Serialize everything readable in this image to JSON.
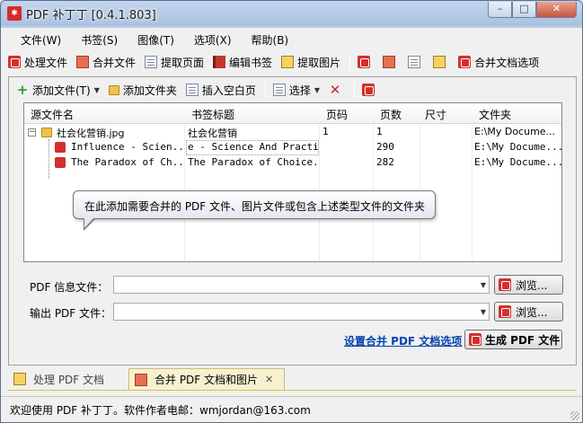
{
  "window": {
    "title": "PDF 补丁丁 [0.4.1.803]",
    "minimize": "–",
    "maximize": "□",
    "close": "✕"
  },
  "menu": [
    "文件(W)",
    "书签(S)",
    "图像(T)",
    "选项(X)",
    "帮助(B)"
  ],
  "toolbar": {
    "process_file": "处理文件",
    "merge_file": "合并文件",
    "extract_pages": "提取页面",
    "edit_bookmarks": "编辑书签",
    "extract_images": "提取图片",
    "merge_options": "合并文档选项"
  },
  "panel_toolbar": {
    "add_file": "添加文件(T)",
    "add_folder": "添加文件夹",
    "insert_blank": "插入空白页",
    "select": "选择"
  },
  "table": {
    "headers": [
      "源文件名",
      "书签标题",
      "页码",
      "页数",
      "尺寸",
      "文件夹"
    ],
    "rows": [
      {
        "name": "社会化营销.jpg",
        "title": "社会化营销",
        "page": "1",
        "count": "1",
        "size": "",
        "folder": "E:\\My Docume..."
      },
      {
        "name": "Influence - Scien...",
        "title": "e - Science And Practice",
        "page": "",
        "count": "290",
        "size": "",
        "folder": "E:\\My Docume..."
      },
      {
        "name": "The Paradox of Ch...",
        "title": "The Paradox of Choice...",
        "page": "",
        "count": "282",
        "size": "",
        "folder": "E:\\My Docume..."
      }
    ]
  },
  "tooltip": "在此添加需要合并的 PDF 文件、图片文件或包含上述类型文件的文件夹",
  "fields": {
    "info_label": "PDF 信息文件：",
    "info_value": "",
    "output_label": "输出 PDF 文件：",
    "output_value": "",
    "browse": "浏览..."
  },
  "actions": {
    "settings_link": "设置合并 PDF 文档选项",
    "generate": "生成 PDF 文件"
  },
  "tabs": [
    {
      "label": "处理 PDF 文档"
    },
    {
      "label": "合并 PDF 文档和图片",
      "close": "✕"
    }
  ],
  "status": "欢迎使用 PDF 补丁丁。软件作者电邮：wmjordan@163.com",
  "colors": {
    "link": "#0645ad",
    "active_tab": "#f7f1cf",
    "pdf_red": "#d32f2f"
  }
}
